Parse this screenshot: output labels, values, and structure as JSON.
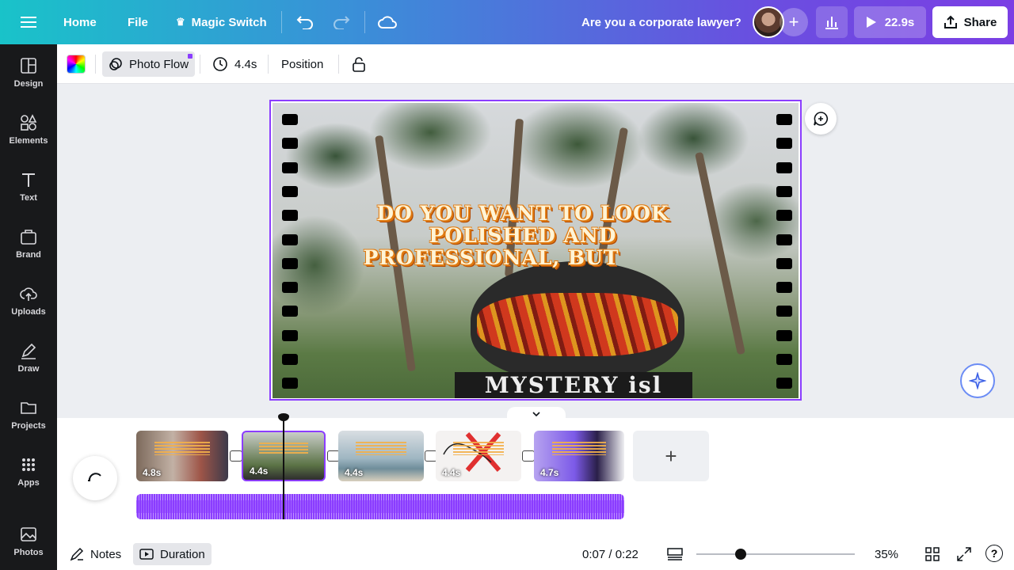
{
  "topbar": {
    "menu_icon": "hamburger-icon",
    "home_label": "Home",
    "file_label": "File",
    "magic_switch_label": "Magic Switch",
    "doc_title": "Are you a corporate lawyer?",
    "present_duration": "22.9s",
    "share_label": "Share"
  },
  "sidebar": {
    "items": [
      {
        "label": "Design",
        "icon": "layout-icon"
      },
      {
        "label": "Elements",
        "icon": "shapes-icon"
      },
      {
        "label": "Text",
        "icon": "text-icon"
      },
      {
        "label": "Brand",
        "icon": "brand-icon"
      },
      {
        "label": "Uploads",
        "icon": "cloud-upload-icon"
      },
      {
        "label": "Draw",
        "icon": "pen-icon"
      },
      {
        "label": "Projects",
        "icon": "folder-icon"
      },
      {
        "label": "Apps",
        "icon": "apps-icon"
      },
      {
        "label": "Photos",
        "icon": "photo-icon"
      }
    ]
  },
  "toolbar": {
    "photo_flow_label": "Photo Flow",
    "duration_label": "4.4s",
    "position_label": "Position"
  },
  "canvas": {
    "headline_line1": "DO YOU WANT TO LOOK",
    "headline_line2": "POLISHED AND",
    "headline_line3": "PROFESSIONAL, BUT",
    "sign_text": "MYSTERY isl"
  },
  "timeline": {
    "clips": [
      {
        "duration": "4.8s"
      },
      {
        "duration": "4.4s"
      },
      {
        "duration": "4.4s"
      },
      {
        "duration": "4.4s"
      },
      {
        "duration": "4.7s"
      }
    ]
  },
  "bottombar": {
    "notes_label": "Notes",
    "duration_label": "Duration",
    "time_display": "0:07 / 0:22",
    "zoom_level": "35%",
    "zoom_fraction": 0.28,
    "help_label": "?"
  },
  "colors": {
    "accent": "#8b3dff",
    "sidebar_bg": "#18191b"
  }
}
